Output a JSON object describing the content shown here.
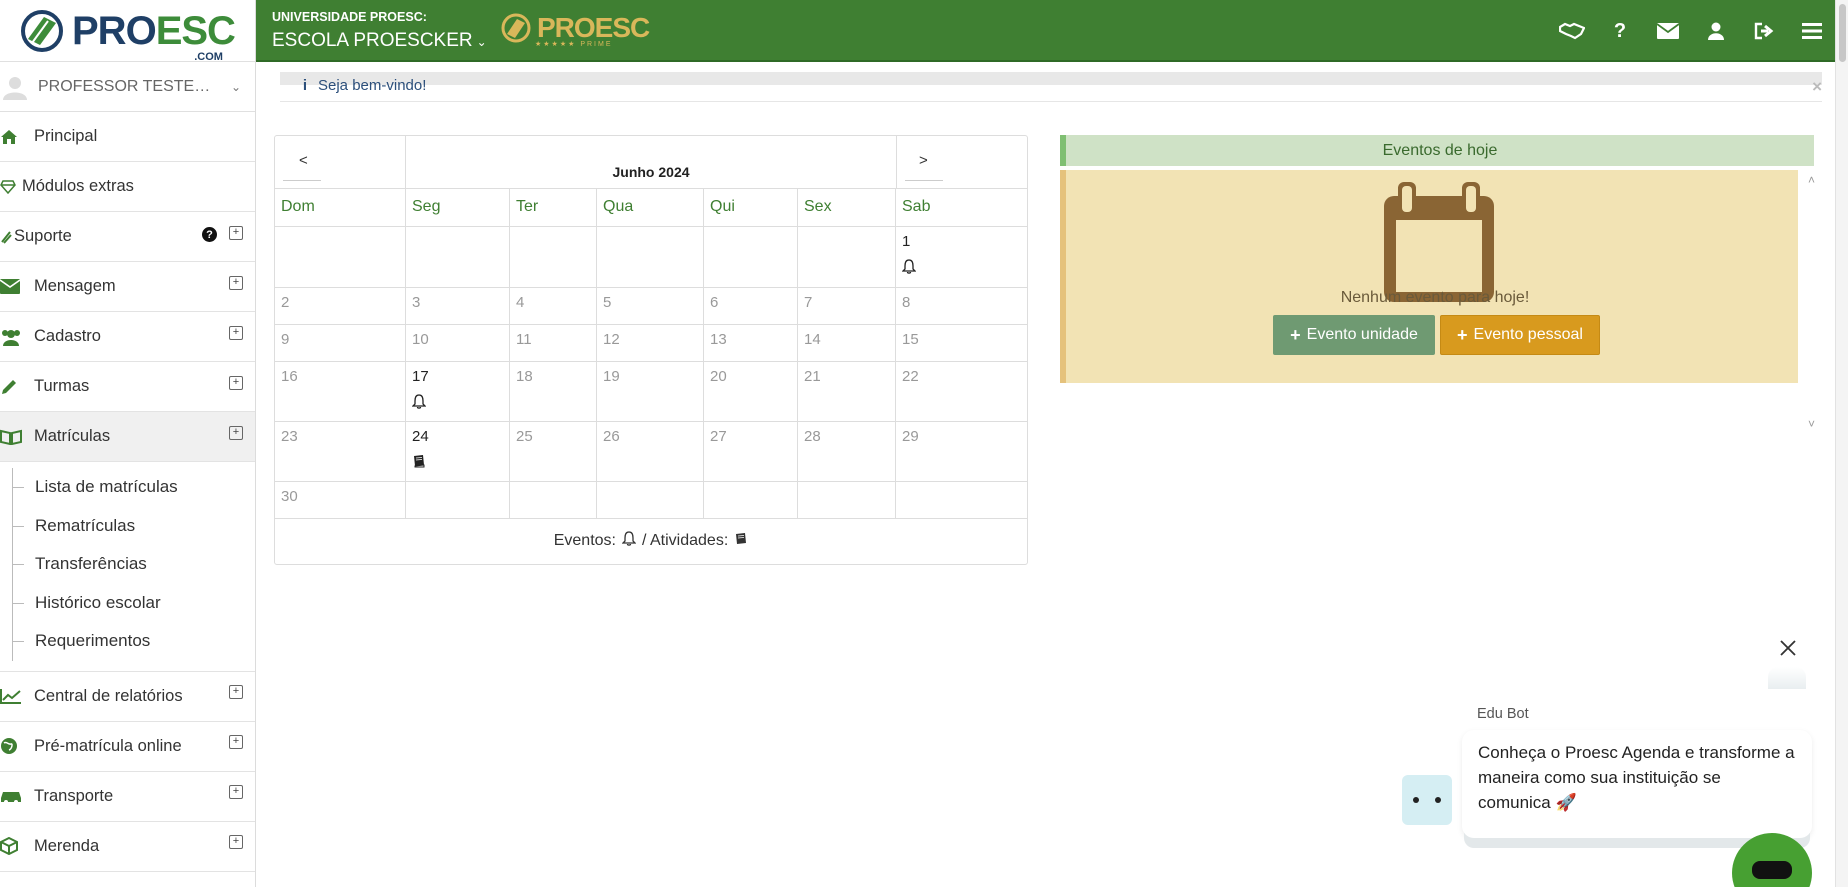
{
  "logo": {
    "pro": "PRO",
    "esc": "ESC",
    "com": ".COM"
  },
  "user": {
    "name": "PROFESSOR TESTE 1..."
  },
  "sidebar": {
    "items": [
      {
        "label": "Principal",
        "icon": "home-icon"
      },
      {
        "label": "Módulos extras",
        "icon": "diamond-icon"
      },
      {
        "label": "Suporte",
        "icon": "ticket-icon"
      },
      {
        "label": "Mensagem",
        "icon": "envelope-icon"
      },
      {
        "label": "Cadastro",
        "icon": "users-icon"
      },
      {
        "label": "Turmas",
        "icon": "pencil-icon"
      },
      {
        "label": "Matrículas",
        "icon": "book-open-icon"
      }
    ],
    "submenu": [
      "Lista de matrículas",
      "Rematrículas",
      "Transferências",
      "Histórico escolar",
      "Requerimentos"
    ],
    "items_bottom": [
      {
        "label": "Central de relatórios",
        "icon": "chart-line-icon"
      },
      {
        "label": "Pré-matrícula online",
        "icon": "globe-icon"
      },
      {
        "label": "Transporte",
        "icon": "car-icon"
      },
      {
        "label": "Merenda",
        "icon": "box-icon"
      }
    ]
  },
  "header": {
    "university": "UNIVERSIDADE PROESC:",
    "school": "ESCOLA PROESCKER",
    "prime_logo": "PROESC",
    "prime_sub": "★★★★★ PRIME"
  },
  "alert": {
    "text": "Seja bem-vindo!",
    "close": "×"
  },
  "calendar": {
    "prev": "<",
    "next": ">",
    "title": "Junho 2024",
    "weekdays": [
      "Dom",
      "Seg",
      "Ter",
      "Qua",
      "Qui",
      "Sex",
      "Sab"
    ],
    "legend_events": "Eventos:",
    "legend_sep": "/ Atividades:"
  },
  "events": {
    "title": "Eventos de hoje",
    "empty": "Nenhum evento para hoje!",
    "btn_unidade": "Evento unidade",
    "btn_pessoal": "Evento pessoal"
  },
  "chat": {
    "bot_name": "Edu Bot",
    "message": "Conheça o Proesc Agenda e transforme a maneira como sua instituição se comunica 🚀"
  },
  "colors": {
    "primary": "#3f7f32",
    "events_header": "#cfe2c6",
    "events_body": "#f2e3b4",
    "btn_unidade": "#6f9a72",
    "btn_pessoal": "#d89a1e"
  }
}
